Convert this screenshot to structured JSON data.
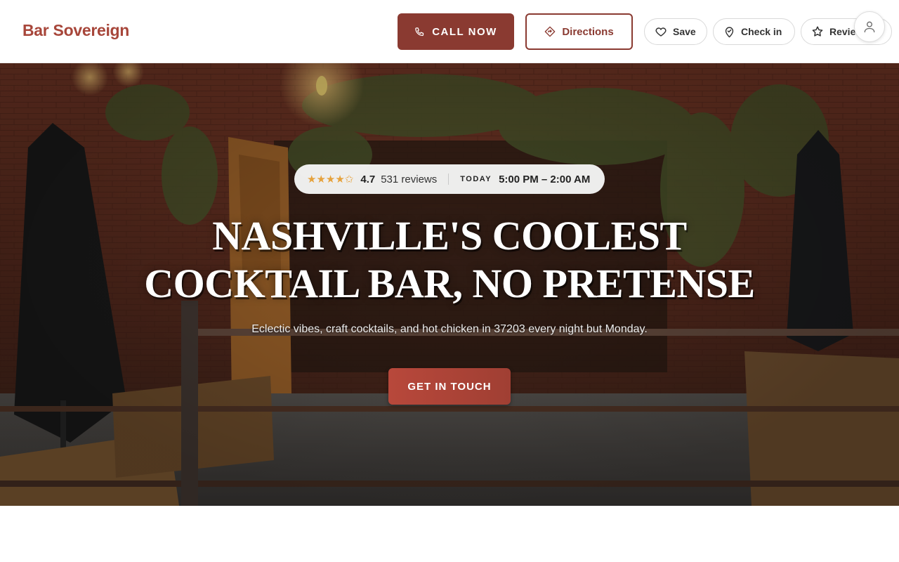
{
  "brand": {
    "name": "Bar Sovereign"
  },
  "header": {
    "call_label": "CALL NOW",
    "directions_label": "Directions",
    "save_label": "Save",
    "checkin_label": "Check in",
    "review_label": "Review"
  },
  "hero": {
    "stars": "★★★★✩",
    "rating": "4.7",
    "reviews": "531 reviews",
    "today_label": "TODAY",
    "hours": "5:00 PM – 2:00 AM",
    "headline_line1": "NASHVILLE'S COOLEST",
    "headline_line2": "COCKTAIL BAR, NO PRETENSE",
    "subheadline": "Eclectic vibes, craft cocktails, and hot chicken in 37203 every night but Monday.",
    "cta_label": "GET IN TOUCH"
  },
  "colors": {
    "brand": "#a7463a",
    "primary_button": "#8a3a31",
    "cta": "#b8483b",
    "star": "#e6a23c"
  },
  "icons": {
    "call": "phone-icon",
    "directions": "directions-icon",
    "save": "heart-icon",
    "checkin": "map-pin-icon",
    "review": "star-icon",
    "account": "user-icon"
  }
}
